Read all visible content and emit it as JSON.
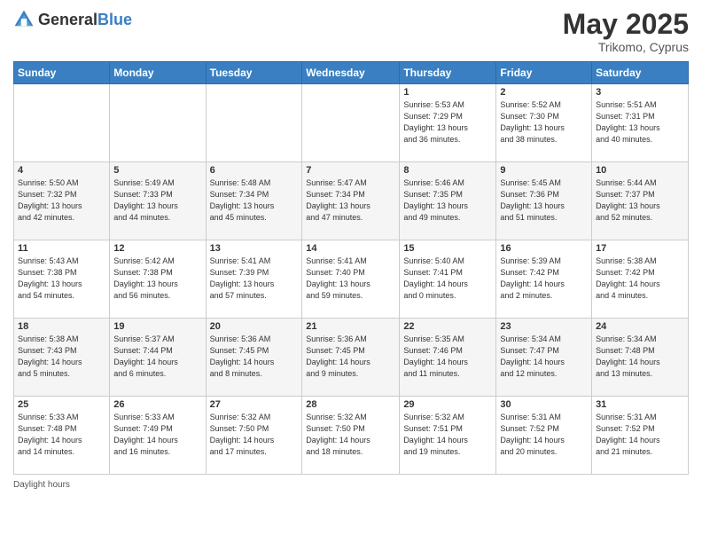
{
  "header": {
    "logo_general": "General",
    "logo_blue": "Blue",
    "title": "May 2025",
    "location": "Trikomo, Cyprus"
  },
  "weekdays": [
    "Sunday",
    "Monday",
    "Tuesday",
    "Wednesday",
    "Thursday",
    "Friday",
    "Saturday"
  ],
  "weeks": [
    [
      {
        "day": "",
        "info": ""
      },
      {
        "day": "",
        "info": ""
      },
      {
        "day": "",
        "info": ""
      },
      {
        "day": "",
        "info": ""
      },
      {
        "day": "1",
        "info": "Sunrise: 5:53 AM\nSunset: 7:29 PM\nDaylight: 13 hours\nand 36 minutes."
      },
      {
        "day": "2",
        "info": "Sunrise: 5:52 AM\nSunset: 7:30 PM\nDaylight: 13 hours\nand 38 minutes."
      },
      {
        "day": "3",
        "info": "Sunrise: 5:51 AM\nSunset: 7:31 PM\nDaylight: 13 hours\nand 40 minutes."
      }
    ],
    [
      {
        "day": "4",
        "info": "Sunrise: 5:50 AM\nSunset: 7:32 PM\nDaylight: 13 hours\nand 42 minutes."
      },
      {
        "day": "5",
        "info": "Sunrise: 5:49 AM\nSunset: 7:33 PM\nDaylight: 13 hours\nand 44 minutes."
      },
      {
        "day": "6",
        "info": "Sunrise: 5:48 AM\nSunset: 7:34 PM\nDaylight: 13 hours\nand 45 minutes."
      },
      {
        "day": "7",
        "info": "Sunrise: 5:47 AM\nSunset: 7:34 PM\nDaylight: 13 hours\nand 47 minutes."
      },
      {
        "day": "8",
        "info": "Sunrise: 5:46 AM\nSunset: 7:35 PM\nDaylight: 13 hours\nand 49 minutes."
      },
      {
        "day": "9",
        "info": "Sunrise: 5:45 AM\nSunset: 7:36 PM\nDaylight: 13 hours\nand 51 minutes."
      },
      {
        "day": "10",
        "info": "Sunrise: 5:44 AM\nSunset: 7:37 PM\nDaylight: 13 hours\nand 52 minutes."
      }
    ],
    [
      {
        "day": "11",
        "info": "Sunrise: 5:43 AM\nSunset: 7:38 PM\nDaylight: 13 hours\nand 54 minutes."
      },
      {
        "day": "12",
        "info": "Sunrise: 5:42 AM\nSunset: 7:38 PM\nDaylight: 13 hours\nand 56 minutes."
      },
      {
        "day": "13",
        "info": "Sunrise: 5:41 AM\nSunset: 7:39 PM\nDaylight: 13 hours\nand 57 minutes."
      },
      {
        "day": "14",
        "info": "Sunrise: 5:41 AM\nSunset: 7:40 PM\nDaylight: 13 hours\nand 59 minutes."
      },
      {
        "day": "15",
        "info": "Sunrise: 5:40 AM\nSunset: 7:41 PM\nDaylight: 14 hours\nand 0 minutes."
      },
      {
        "day": "16",
        "info": "Sunrise: 5:39 AM\nSunset: 7:42 PM\nDaylight: 14 hours\nand 2 minutes."
      },
      {
        "day": "17",
        "info": "Sunrise: 5:38 AM\nSunset: 7:42 PM\nDaylight: 14 hours\nand 4 minutes."
      }
    ],
    [
      {
        "day": "18",
        "info": "Sunrise: 5:38 AM\nSunset: 7:43 PM\nDaylight: 14 hours\nand 5 minutes."
      },
      {
        "day": "19",
        "info": "Sunrise: 5:37 AM\nSunset: 7:44 PM\nDaylight: 14 hours\nand 6 minutes."
      },
      {
        "day": "20",
        "info": "Sunrise: 5:36 AM\nSunset: 7:45 PM\nDaylight: 14 hours\nand 8 minutes."
      },
      {
        "day": "21",
        "info": "Sunrise: 5:36 AM\nSunset: 7:45 PM\nDaylight: 14 hours\nand 9 minutes."
      },
      {
        "day": "22",
        "info": "Sunrise: 5:35 AM\nSunset: 7:46 PM\nDaylight: 14 hours\nand 11 minutes."
      },
      {
        "day": "23",
        "info": "Sunrise: 5:34 AM\nSunset: 7:47 PM\nDaylight: 14 hours\nand 12 minutes."
      },
      {
        "day": "24",
        "info": "Sunrise: 5:34 AM\nSunset: 7:48 PM\nDaylight: 14 hours\nand 13 minutes."
      }
    ],
    [
      {
        "day": "25",
        "info": "Sunrise: 5:33 AM\nSunset: 7:48 PM\nDaylight: 14 hours\nand 14 minutes."
      },
      {
        "day": "26",
        "info": "Sunrise: 5:33 AM\nSunset: 7:49 PM\nDaylight: 14 hours\nand 16 minutes."
      },
      {
        "day": "27",
        "info": "Sunrise: 5:32 AM\nSunset: 7:50 PM\nDaylight: 14 hours\nand 17 minutes."
      },
      {
        "day": "28",
        "info": "Sunrise: 5:32 AM\nSunset: 7:50 PM\nDaylight: 14 hours\nand 18 minutes."
      },
      {
        "day": "29",
        "info": "Sunrise: 5:32 AM\nSunset: 7:51 PM\nDaylight: 14 hours\nand 19 minutes."
      },
      {
        "day": "30",
        "info": "Sunrise: 5:31 AM\nSunset: 7:52 PM\nDaylight: 14 hours\nand 20 minutes."
      },
      {
        "day": "31",
        "info": "Sunrise: 5:31 AM\nSunset: 7:52 PM\nDaylight: 14 hours\nand 21 minutes."
      }
    ]
  ],
  "footer": {
    "daylight_hours": "Daylight hours"
  }
}
